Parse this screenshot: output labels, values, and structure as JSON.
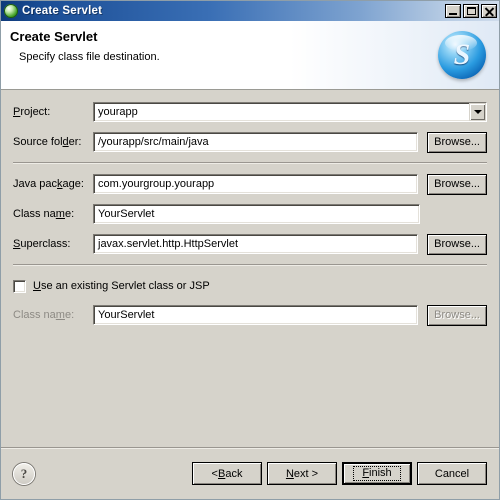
{
  "window": {
    "title": "Create Servlet",
    "icon": "servlet-app-icon",
    "controls": [
      {
        "name": "minimize",
        "glyph": "minimize-icon"
      },
      {
        "name": "maximize",
        "glyph": "maximize-icon"
      },
      {
        "name": "close",
        "glyph": "close-icon"
      }
    ]
  },
  "banner": {
    "title": "Create Servlet",
    "subtitle": "Specify class file destination.",
    "logo": "s-badge-logo",
    "logo_letter": "S",
    "logo_color": "#2a9be0"
  },
  "form": {
    "project": {
      "label_pre": "P",
      "label_mn": "",
      "label": "Project:",
      "label_a": "P",
      "label_b": "roject:",
      "value": "yourapp",
      "control": "combobox"
    },
    "source_folder": {
      "label_a": "Source fol",
      "label_b": "d",
      "label_c": "er:",
      "value": "/yourapp/src/main/java",
      "browse": "Browse..."
    },
    "java_package": {
      "label_a": "Java pac",
      "label_b": "k",
      "label_c": "age:",
      "value": "com.yourgroup.yourapp",
      "browse": "Browse..."
    },
    "class_name": {
      "label_a": "Class na",
      "label_b": "m",
      "label_c": "e:",
      "value": "YourServlet"
    },
    "superclass": {
      "label_a": "",
      "label_b": "S",
      "label_c": "uperclass:",
      "value": "javax.servlet.http.HttpServlet",
      "browse": "Browse..."
    },
    "existing_checkbox": {
      "label_a": "",
      "label_b": "U",
      "label_c": "se an existing Servlet class or JSP",
      "checked": false
    },
    "existing_class_name": {
      "label_a": "Class na",
      "label_b": "m",
      "label_c": "e:",
      "value": "YourServlet",
      "browse": "Browse...",
      "disabled": true
    }
  },
  "footer": {
    "help": "?",
    "back": {
      "a": "< ",
      "b": "B",
      "c": "ack"
    },
    "next": {
      "a": "",
      "b": "N",
      "c": "ext >"
    },
    "finish": {
      "a": "",
      "b": "F",
      "c": "inish"
    },
    "cancel": {
      "a": "",
      "b": "",
      "c": "Cancel"
    }
  }
}
